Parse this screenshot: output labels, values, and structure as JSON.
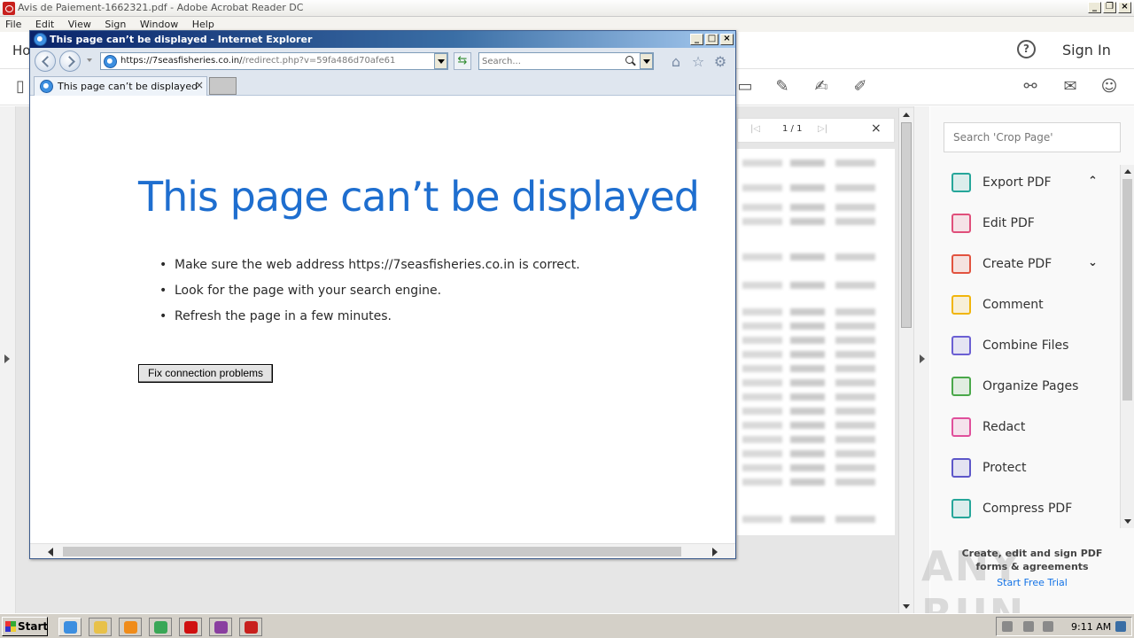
{
  "acrobat": {
    "window_title": "Avis de Paiement-1662321.pdf - Adobe Acrobat Reader DC",
    "menu": [
      "File",
      "Edit",
      "View",
      "Sign",
      "Window",
      "Help"
    ],
    "topbar": {
      "home_label": "Ho",
      "help_icon": "?",
      "sign_in": "Sign In"
    },
    "page_nav": {
      "page_display": "1 / 1",
      "close": "×"
    },
    "search_placeholder": "Search 'Crop Page'",
    "tools": [
      {
        "label": "Export PDF",
        "icon": "export-pdf-icon",
        "color": "#26a69a",
        "chevron": "⌃"
      },
      {
        "label": "Edit PDF",
        "icon": "edit-pdf-icon",
        "color": "#e04f7b",
        "chevron": ""
      },
      {
        "label": "Create PDF",
        "icon": "create-pdf-icon",
        "color": "#e2533f",
        "chevron": "⌄"
      },
      {
        "label": "Comment",
        "icon": "comment-icon",
        "color": "#f1b50b",
        "chevron": ""
      },
      {
        "label": "Combine Files",
        "icon": "combine-files-icon",
        "color": "#6b5fd3",
        "chevron": ""
      },
      {
        "label": "Organize Pages",
        "icon": "organize-pages-icon",
        "color": "#4aa84a",
        "chevron": ""
      },
      {
        "label": "Redact",
        "icon": "redact-icon",
        "color": "#e04f9b",
        "chevron": ""
      },
      {
        "label": "Protect",
        "icon": "protect-icon",
        "color": "#5d57c9",
        "chevron": ""
      },
      {
        "label": "Compress PDF",
        "icon": "compress-pdf-icon",
        "color": "#26a69a",
        "chevron": ""
      }
    ],
    "promo": {
      "line1": "Create, edit and sign PDF",
      "line2": "forms & agreements",
      "link": "Start Free Trial"
    },
    "watermark": "ANY RUN"
  },
  "ie": {
    "window_title": "This page can’t be displayed - Internet Explorer",
    "address": {
      "host": "https://7seasfisheries.co.in/",
      "path": "/redirect.php?v=59fa486d70afe61"
    },
    "search_placeholder": "Search...",
    "tab_label": "This page can’t be displayed",
    "tab_close": "×",
    "error": {
      "title": "This page can’t be displayed",
      "bullets": [
        "Make sure the web address https://7seasfisheries.co.in is correct.",
        "Look for the page with your search engine.",
        "Refresh the page in a few minutes."
      ],
      "fix_button": "Fix connection problems"
    }
  },
  "taskbar": {
    "start_label": "Start",
    "apps": [
      {
        "name": "internet-explorer",
        "color": "#3d8fe0",
        "active": true
      },
      {
        "name": "file-explorer",
        "color": "#e8c14a",
        "active": false
      },
      {
        "name": "media-player",
        "color": "#f08c1a",
        "active": false
      },
      {
        "name": "chrome",
        "color": "#3aa757",
        "active": false
      },
      {
        "name": "opera",
        "color": "#d01010",
        "active": false
      },
      {
        "name": "winrar",
        "color": "#8a3fa0",
        "active": false
      },
      {
        "name": "acrobat-reader",
        "color": "#c8201d",
        "active": false
      }
    ],
    "clock": "9:11 AM"
  }
}
